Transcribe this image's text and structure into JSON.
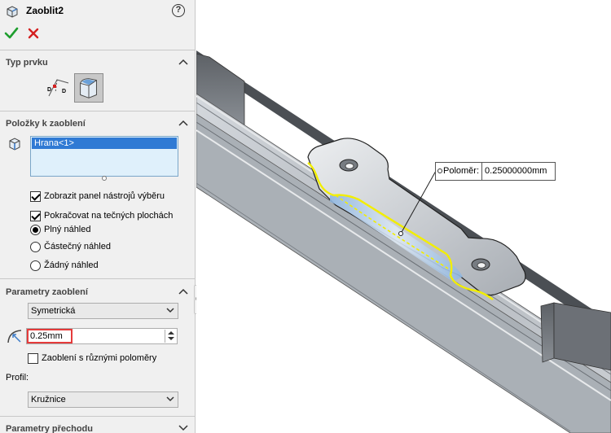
{
  "feature": {
    "title": "Zaoblit2",
    "help_label": "?"
  },
  "groups": {
    "type": {
      "label": "Typ prvku"
    },
    "items": {
      "label": "Položky k zaoblení"
    },
    "params": {
      "label": "Parametry zaoblení"
    },
    "transition": {
      "label": "Parametry přechodu"
    }
  },
  "items_list": [
    "Hrana<1>"
  ],
  "options": {
    "show_toolbar": {
      "label": "Zobrazit panel nástrojů výběru",
      "checked": true
    },
    "tangent": {
      "label": "Pokračovat na tečných plochách",
      "checked": true
    },
    "preview_full": {
      "label": "Plný náhled",
      "selected": true
    },
    "preview_partial": {
      "label": "Částečný náhled",
      "selected": false
    },
    "preview_none": {
      "label": "Žádný náhled",
      "selected": false
    }
  },
  "params": {
    "type_value": "Symetrická",
    "radius_value": "0.25mm",
    "multi_radius_label": "Zaoblení s různými poloměry",
    "multi_radius_checked": false,
    "profile_label": "Profil:",
    "profile_value": "Kružnice"
  },
  "callout": {
    "label": "Poloměr:",
    "value": "0.25000000mm"
  },
  "colors": {
    "accept": "#1e9e2e",
    "cancel": "#d42020",
    "selection_highlight": "#2f7ad4",
    "edge_highlight": "#f2ee00",
    "radius_field_border": "#e53b3b"
  }
}
